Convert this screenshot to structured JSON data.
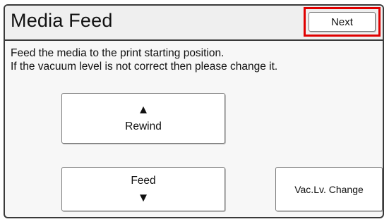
{
  "header": {
    "title": "Media Feed",
    "next_label": "Next"
  },
  "message": {
    "line1": "Feed the media to the print starting position.",
    "line2": "If the vacuum level is not correct then please change it."
  },
  "buttons": {
    "rewind_label": "Rewind",
    "rewind_icon": "up-triangle-icon",
    "feed_label": "Feed",
    "feed_icon": "down-triangle-icon",
    "vac_label": "Vac.Lv. Change"
  },
  "colors": {
    "highlight_border": "#e00000"
  }
}
